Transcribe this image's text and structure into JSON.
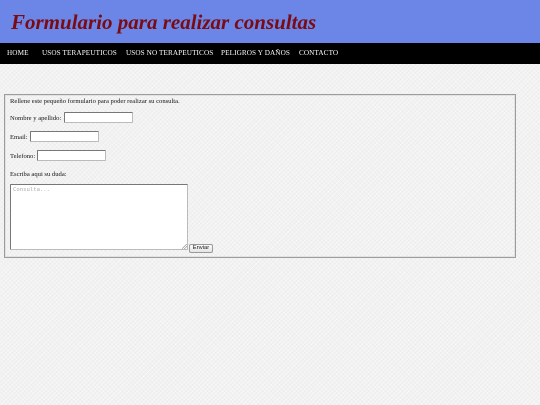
{
  "header": {
    "title": "Formulario para realizar consultas",
    "background_color": "#6b86e6",
    "title_color": "#7a0b13"
  },
  "nav": {
    "items": [
      {
        "label": "HOME"
      },
      {
        "label": "USOS TERAPEUTICOS"
      },
      {
        "label": "USOS NO TERAPEUTICOS"
      },
      {
        "label": "PELIGROS Y DAÑOS"
      },
      {
        "label": "CONTACTO"
      }
    ],
    "background_color": "#000000"
  },
  "form": {
    "intro": "Rellene este pequeño formulario para poder realizar su consulta.",
    "name_label": "Nombre y apellido:",
    "name_value": "",
    "email_label": "Email:",
    "email_value": "",
    "phone_label": "Telefono:",
    "phone_value": "",
    "question_label": "Escriba aqui su duda:",
    "question_placeholder": "Consulta...",
    "question_value": "",
    "submit_label": "Enviar"
  }
}
